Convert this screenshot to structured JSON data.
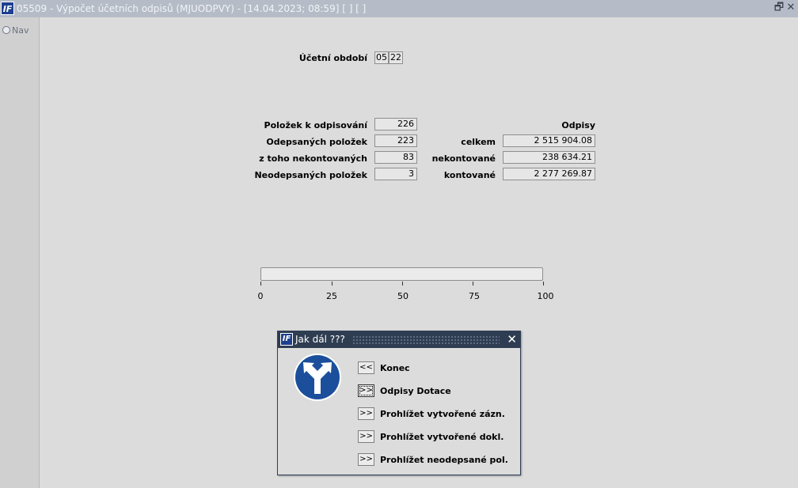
{
  "window": {
    "title": "05509 - Výpočet účetních odpisů (MJUODPVY) - [14.04.2023; 08:59]  [ ]  [ ]",
    "app_icon": "IF-logo-icon",
    "restore_symbol": "🗗",
    "close_symbol": "✕"
  },
  "sidebar": {
    "nav_label": "Nav"
  },
  "period": {
    "label": "Účetní období",
    "month": "05",
    "year": "22"
  },
  "counts": [
    {
      "label": "Položek k odpisování",
      "value": "226"
    },
    {
      "label": "Odepsaných položek",
      "value": "223"
    },
    {
      "label": "z toho nekontovaných",
      "value": "83"
    },
    {
      "label": "Neodepsaných položek",
      "value": "3"
    }
  ],
  "odpisy": {
    "heading": "Odpisy",
    "rows": [
      {
        "label": "celkem",
        "value": "2 515 904.08"
      },
      {
        "label": "nekontované",
        "value": "238 634.21"
      },
      {
        "label": "kontované",
        "value": "2 277 269.87"
      }
    ]
  },
  "progress": {
    "percent": 0,
    "ticks": [
      "0",
      "25",
      "50",
      "75",
      "100"
    ]
  },
  "dialog": {
    "title": "Jak dál ???",
    "close_symbol": "✕",
    "sign_icon": "direction-split-arrow-icon",
    "options": [
      {
        "button": "<<",
        "label": "Konec"
      },
      {
        "button": ">>",
        "label": "Odpisy Dotace"
      },
      {
        "button": ">>",
        "label": "Prohlížet vytvořené zázn."
      },
      {
        "button": ">>",
        "label": "Prohlížet vytvořené dokl."
      },
      {
        "button": ">>",
        "label": "Prohlížet neodepsané pol."
      }
    ]
  },
  "colors": {
    "background": "#dcdcdc",
    "titlebar": "#b5bcc7",
    "dialog_titlebar": "#2f3d52",
    "sign_blue": "#1b4f9c"
  }
}
